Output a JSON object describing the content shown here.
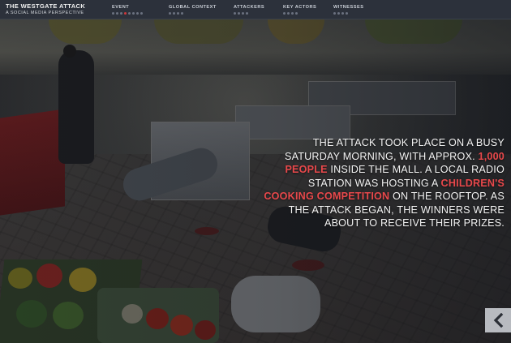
{
  "brand": {
    "title": "THE WESTGATE ATTACK",
    "subtitle": "A SOCIAL MEDIA PERSPECTIVE"
  },
  "nav": [
    {
      "label": "EVENT",
      "dots": 8,
      "active_dot": 3
    },
    {
      "label": "GLOBAL CONTEXT",
      "dots": 4,
      "active_dot": -1
    },
    {
      "label": "ATTACKERS",
      "dots": 4,
      "active_dot": -1
    },
    {
      "label": "KEY ACTORS",
      "dots": 4,
      "active_dot": -1
    },
    {
      "label": "WITNESSES",
      "dots": 4,
      "active_dot": -1
    }
  ],
  "narrative": {
    "part1": "THE ATTACK TOOK PLACE ON A BUSY SATURDAY MORNING, WITH APPROX. ",
    "highlight1": "1,000 PEOPLE",
    "part2": " INSIDE THE MALL. A LOCAL RADIO STATION WAS HOSTING A ",
    "highlight2": "CHILDREN'S COOKING COMPETITION",
    "part3": " ON THE ROOFTOP. AS THE ATTACK BEGAN, THE WINNERS WERE ABOUT TO RECEIVE THEIR PRIZES."
  },
  "back_button": {
    "icon": "chevron-left-icon"
  },
  "colors": {
    "accent": "#e8484b",
    "nav_bg": "#2c313b",
    "text": "#f3f3f3"
  }
}
